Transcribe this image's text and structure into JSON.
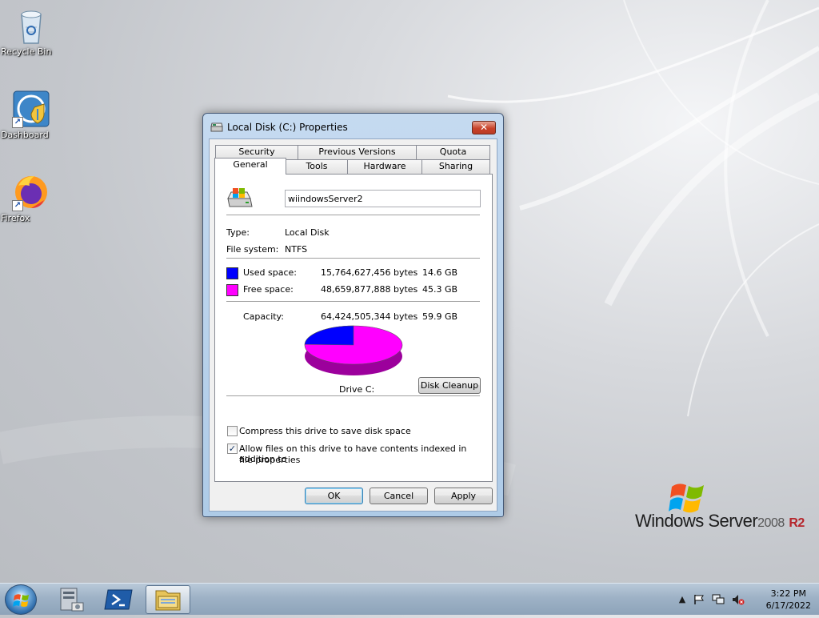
{
  "desktop": {
    "icons": [
      {
        "label": "Recycle Bin",
        "icon": "recycle-bin-icon"
      },
      {
        "label": "Dashboard",
        "icon": "dashboard-icon"
      },
      {
        "label": "Firefox",
        "icon": "firefox-icon"
      }
    ],
    "branding": {
      "product": "Windows Server",
      "version": "2008",
      "release": "R2"
    }
  },
  "dialog": {
    "title": "Local Disk (C:) Properties",
    "close_label": "✕",
    "tabs_back": [
      "Security",
      "Previous Versions",
      "Quota"
    ],
    "tabs_front": [
      "General",
      "Tools",
      "Hardware",
      "Sharing"
    ],
    "active_tab": "General",
    "general": {
      "volume_name": "wiindowsServer2",
      "type_label": "Type:",
      "type_value": "Local Disk",
      "fs_label": "File system:",
      "fs_value": "NTFS",
      "used_label": "Used space:",
      "used_bytes": "15,764,627,456 bytes",
      "used_gb": "14.6 GB",
      "free_label": "Free space:",
      "free_bytes": "48,659,877,888 bytes",
      "free_gb": "45.3 GB",
      "capacity_label": "Capacity:",
      "capacity_bytes": "64,424,505,344 bytes",
      "capacity_gb": "59.9 GB",
      "drive_label": "Drive C:",
      "disk_cleanup_label": "Disk Cleanup",
      "compress_label": "Compress this drive to save disk space",
      "compress_checked": false,
      "index_label_line1": "Allow files on this drive to have contents indexed in addition to",
      "index_label_line2": "file properties",
      "index_checked": true
    },
    "buttons": {
      "ok": "OK",
      "cancel": "Cancel",
      "apply": "Apply"
    }
  },
  "disk": {
    "used_fraction": 0.2447,
    "used_color": "#0000ff",
    "used_side_color": "#00009c",
    "free_color": "#ff00ff",
    "free_side_color": "#9c009c"
  },
  "taskbar": {
    "start_icon": "windows-start-orb",
    "pinned": [
      {
        "name": "server-manager-icon"
      },
      {
        "name": "powershell-icon"
      },
      {
        "name": "file-explorer-icon",
        "active": true
      }
    ],
    "tray": {
      "show_hidden": "▲",
      "icons": [
        "action-center-flag-icon",
        "network-icon",
        "volume-muted-icon"
      ],
      "time": "3:22 PM",
      "date": "6/17/2022"
    }
  }
}
